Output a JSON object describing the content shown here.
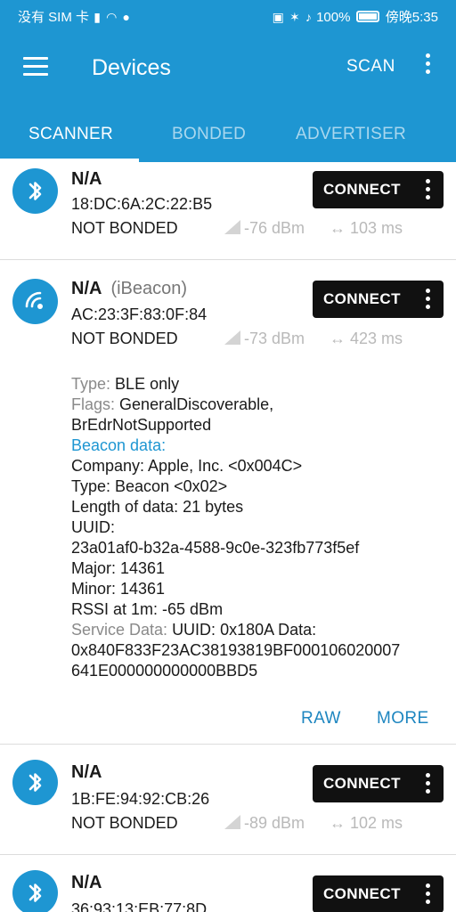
{
  "status_bar": {
    "carrier": "没有 SIM 卡",
    "battery": "100%",
    "time": "傍晚5:35"
  },
  "app_bar": {
    "title": "Devices",
    "scan_label": "SCAN",
    "tabs": [
      {
        "label": "SCANNER",
        "active": true
      },
      {
        "label": "BONDED",
        "active": false
      },
      {
        "label": "ADVERTISER",
        "active": false
      }
    ]
  },
  "colors": {
    "accent": "#1e96d2",
    "button": "#111111",
    "link": "#1e86c0"
  },
  "devices": [
    {
      "icon": "bluetooth-icon",
      "name": "N/A",
      "address": "18:DC:6A:2C:22:B5",
      "bond_state": "NOT BONDED",
      "rssi": "-76 dBm",
      "interval": "103 ms",
      "connect_label": "CONNECT"
    },
    {
      "icon": "beacon-icon",
      "name": "N/A",
      "type_tag": "(iBeacon)",
      "address": "AC:23:3F:83:0F:84",
      "bond_state": "NOT BONDED",
      "rssi": "-73 dBm",
      "interval": "423 ms",
      "connect_label": "CONNECT",
      "details": {
        "type_key": "Type:",
        "type_val": "BLE only",
        "flags_key": "Flags:",
        "flags_val_1": "GeneralDiscoverable,",
        "flags_val_2": "BrEdrNotSupported",
        "beacon_header": "Beacon data:",
        "company": "Company: Apple, Inc. <0x004C>",
        "beacon_type": "Type: Beacon <0x02>",
        "length": "Length of data: 21 bytes",
        "uuid_label": "UUID:",
        "uuid": "23a01af0-b32a-4588-9c0e-323fb773f5ef",
        "major": "Major: 14361",
        "minor": "Minor: 14361",
        "rssi_1m": "RSSI at 1m: -65 dBm",
        "service_key": "Service Data:",
        "service_val": "UUID: 0x180A Data:",
        "service_data_1": "0x840F833F23AC38193819BF000106020007",
        "service_data_2": "641E000000000000BBD5"
      },
      "raw_label": "RAW",
      "more_label": "MORE"
    },
    {
      "icon": "bluetooth-icon",
      "name": "N/A",
      "address": "1B:FE:94:92:CB:26",
      "bond_state": "NOT BONDED",
      "rssi": "-89 dBm",
      "interval": "102 ms",
      "connect_label": "CONNECT"
    },
    {
      "icon": "bluetooth-icon",
      "name": "N/A",
      "address": "36:93:13:EB:77:8D",
      "connect_label": "CONNECT"
    }
  ]
}
